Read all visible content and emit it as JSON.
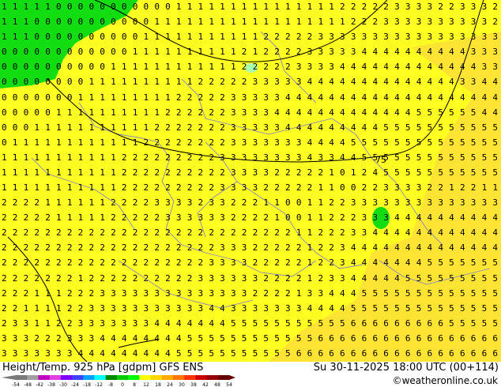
{
  "title_left": "Height/Temp. 925 hPa [gdpm] GFS ENS",
  "title_right": "Su 30-11-2025 18:00 UTC (00+114)",
  "credit": "©weatheronline.co.uk",
  "contour_label": "75",
  "colorbar": {
    "ticks": [
      "-54",
      "-48",
      "-42",
      "-38",
      "-30",
      "-24",
      "-18",
      "-12",
      "-8",
      "0",
      "8",
      "12",
      "18",
      "24",
      "30",
      "38",
      "42",
      "48",
      "54"
    ],
    "colors": [
      "#7a7a7a",
      "#a0a0a0",
      "#c000c0",
      "#e040e0",
      "#8000ff",
      "#4040ff",
      "#00a0ff",
      "#00ffff",
      "#008800",
      "#00cc00",
      "#00ff00",
      "#ffff00",
      "#ffd700",
      "#ffaa00",
      "#ff7700",
      "#ff3300",
      "#cc0000",
      "#990000",
      "#660000"
    ]
  },
  "colors": {
    "field_main": "#ffff22",
    "field_warm": "#ffe433",
    "field_cold": "#11dd11",
    "contour": "#000000",
    "borders": "#8888bb"
  },
  "grid_values": [
    "1111100000000000111111111111111222223333223332",
    "1110000000000011111111111111111122233333333332",
    "1110000000000111111111112222233333333333333333",
    "0000000000001111111111212222333334444444444333",
    "0000000000111111111111222223333444444444444433",
    "0000000011111111112222233333444444444444443344",
    "0000000111111111222223333344444444444444444444",
    "0000011111111112222223333444444444444455555544",
    "0001111111111122222223333344444444455555555555",
    "0111111111111222222223333333444455555555555555",
    "1111111111122222222233333333433445555555555555",
    "1111111111122222222223333222221012455555555555",
    "1111111111122222222233332222211002233332212211",
    "2222111111222233332332221100112233333333333333",
    "2222211111222223333332222100112223334444444444",
    "2222222222222222222222222221122233444444444444",
    "2222222222222222222233322222122344444444444444",
    "2222222222222222222333322222122344444445555555",
    "2222222122222222223333332222123344444555555555",
    "2221112223333333333333322221334445555555555555",
    "2211112233333333333443333333444455555555555555",
    "2331122333333344444445555555555566666666655555",
    "3332223334444444455555555555566666666666666666",
    "3333333444444444555555555556666666666666666666"
  ]
}
